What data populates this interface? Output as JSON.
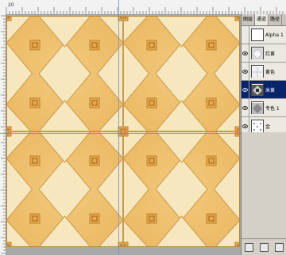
{
  "ruler": {
    "label": "20"
  },
  "panel": {
    "tabs": [
      {
        "label": "图层"
      },
      {
        "label": "通道"
      },
      {
        "label": "路径"
      }
    ],
    "active_tab": "通道",
    "channels": [
      {
        "name": "Alpha 1",
        "visible": false,
        "thumbnail": "alpha-white"
      },
      {
        "name": "红黄",
        "visible": true,
        "thumbnail": "tile-pattern"
      },
      {
        "name": "黄色",
        "visible": true,
        "thumbnail": "tile-pattern"
      },
      {
        "name": "米黄",
        "visible": true,
        "thumbnail": "tile-pattern",
        "selected": true
      },
      {
        "name": "专色 1",
        "visible": true,
        "thumbnail": "gradient"
      },
      {
        "name": "金",
        "visible": true,
        "thumbnail": "sparse"
      }
    ]
  },
  "colors": {
    "tile_light": "#f6e6bd",
    "tile_orange": "#f0c070",
    "grout": "#c79a4c",
    "guide": "#6b8fd6",
    "panel_bg": "#d4d0c8",
    "selected_row": "#0a246a"
  }
}
